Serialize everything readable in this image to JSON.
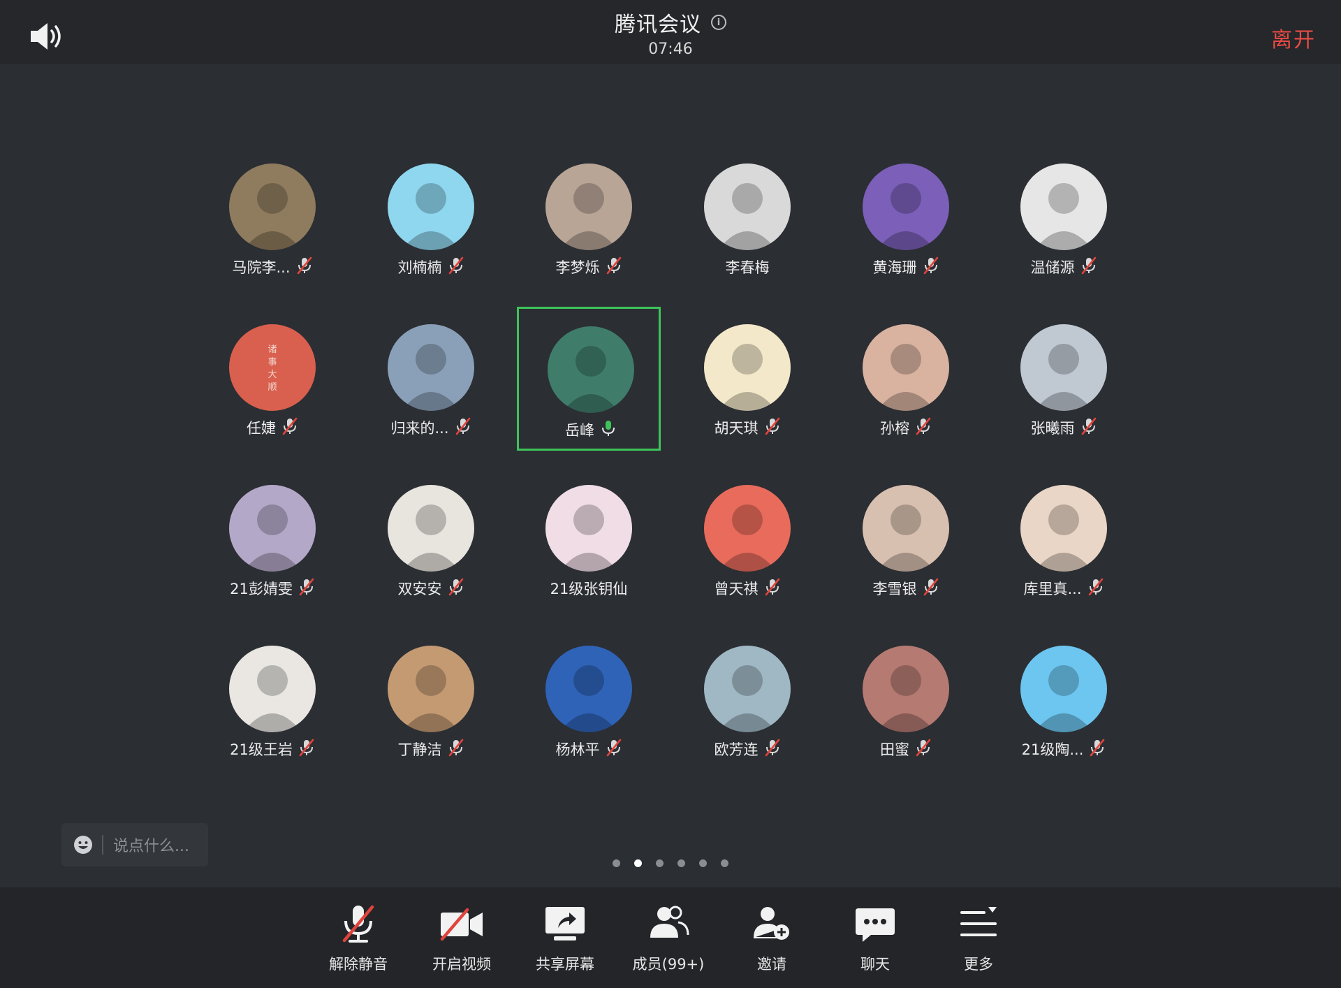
{
  "topbar": {
    "title": "腾讯会议",
    "time": "07:46",
    "leave_label": "离开"
  },
  "participants": [
    {
      "name": "马院李...",
      "muted": true,
      "bg": "#8f7b5e"
    },
    {
      "name": "刘楠楠",
      "muted": true,
      "bg": "#8fd7ef"
    },
    {
      "name": "李梦烁",
      "muted": true,
      "bg": "#b9a596"
    },
    {
      "name": "李春梅",
      "muted": false,
      "bg": "#d9d9d9"
    },
    {
      "name": "黄海珊",
      "muted": true,
      "bg": "#7b5fb8"
    },
    {
      "name": "温储源",
      "muted": true,
      "bg": "#e6e6e6"
    },
    {
      "name": "任婕",
      "muted": true,
      "bg": "#d9604e",
      "text": "诸事大顺"
    },
    {
      "name": "归来的...",
      "muted": true,
      "bg": "#8aa0b8"
    },
    {
      "name": "岳峰",
      "muted": false,
      "speaking": true,
      "active": true,
      "bg": "#3f7d6a"
    },
    {
      "name": "胡天琪",
      "muted": true,
      "bg": "#f3e8c9"
    },
    {
      "name": "孙榕",
      "muted": true,
      "bg": "#d9b3a0"
    },
    {
      "name": "张曦雨",
      "muted": true,
      "bg": "#c0c8d2"
    },
    {
      "name": "21彭婧雯",
      "muted": true,
      "bg": "#b4a8c9"
    },
    {
      "name": "双安安",
      "muted": true,
      "bg": "#e8e4de"
    },
    {
      "name": "21级张钥仙",
      "muted": false,
      "bg": "#f0dde6"
    },
    {
      "name": "曾天祺",
      "muted": true,
      "bg": "#e86b5c"
    },
    {
      "name": "李雪银",
      "muted": true,
      "bg": "#d8c0b0"
    },
    {
      "name": "库里真...",
      "muted": true,
      "bg": "#e9d6c6"
    },
    {
      "name": "21级王岩",
      "muted": true,
      "bg": "#eae7e3"
    },
    {
      "name": "丁静洁",
      "muted": true,
      "bg": "#c49a73"
    },
    {
      "name": "杨林平",
      "muted": true,
      "bg": "#2f63b8"
    },
    {
      "name": "欧芳连",
      "muted": true,
      "bg": "#9fb8c4"
    },
    {
      "name": "田蜜",
      "muted": true,
      "bg": "#b57a72"
    },
    {
      "name": "21级陶...",
      "muted": true,
      "bg": "#6cc6ef"
    }
  ],
  "chat": {
    "placeholder": "说点什么..."
  },
  "pager": {
    "count": 6,
    "current": 2
  },
  "toolbar": [
    {
      "key": "unmute",
      "label": "解除静音",
      "icon": "mic-off-icon"
    },
    {
      "key": "video",
      "label": "开启视频",
      "icon": "camera-off-icon"
    },
    {
      "key": "share",
      "label": "共享屏幕",
      "icon": "share-screen-icon"
    },
    {
      "key": "members",
      "label": "成员(99+)",
      "icon": "members-icon"
    },
    {
      "key": "invite",
      "label": "邀请",
      "icon": "add-user-icon"
    },
    {
      "key": "chat",
      "label": "聊天",
      "icon": "chat-bubble-icon"
    },
    {
      "key": "more",
      "label": "更多",
      "icon": "more-menu-icon"
    }
  ],
  "colors": {
    "accent_leave": "#e94b44",
    "active_border": "#3ec45a",
    "mute_red": "#e0443c"
  }
}
